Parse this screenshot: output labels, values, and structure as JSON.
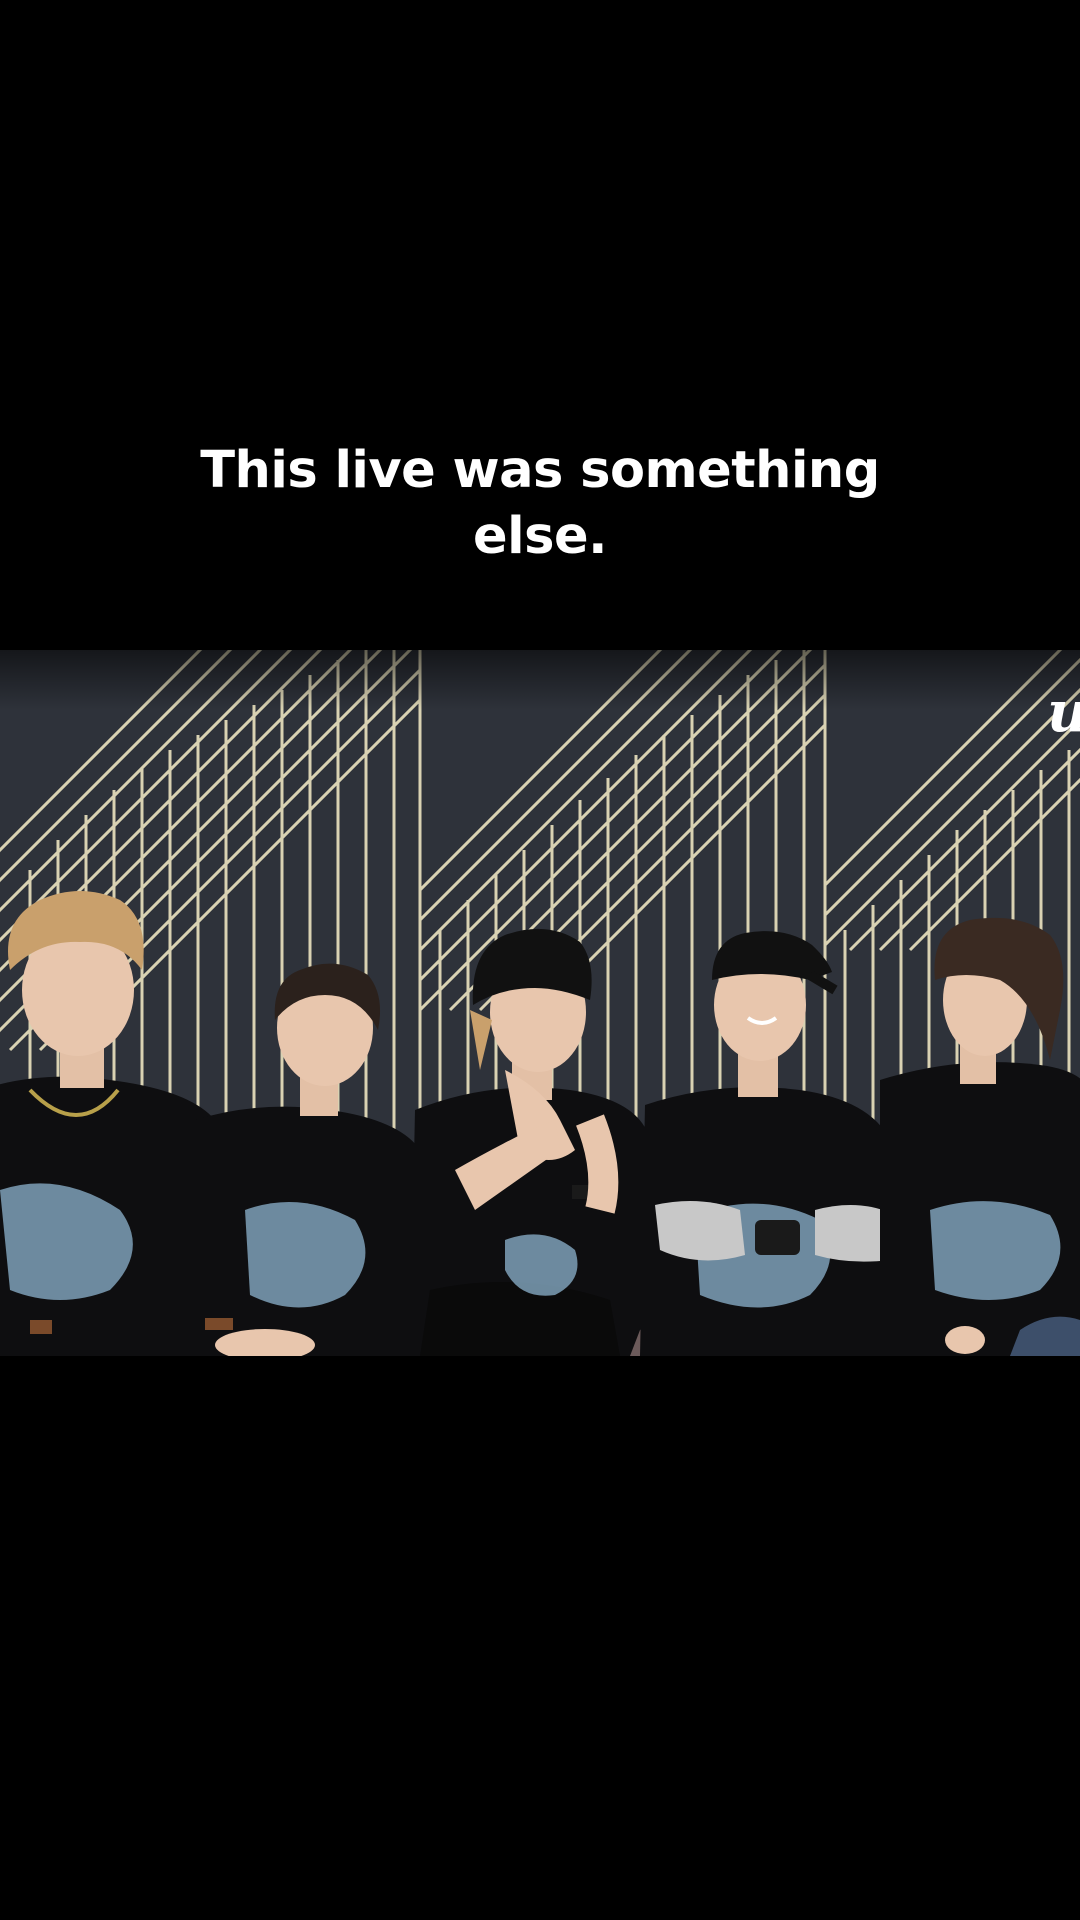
{
  "caption": {
    "text": "This live was something else."
  },
  "video": {
    "logo_mark": "u",
    "colors": {
      "wall": "#2e323a",
      "stripe": "#d9d2b3",
      "shirt": "#0e0e10",
      "print": "#8db4cf",
      "skin": "#e8c6ad",
      "hair_blond": "#c9a06c",
      "hair_dark": "#2b211c",
      "couch": "#151515"
    }
  }
}
